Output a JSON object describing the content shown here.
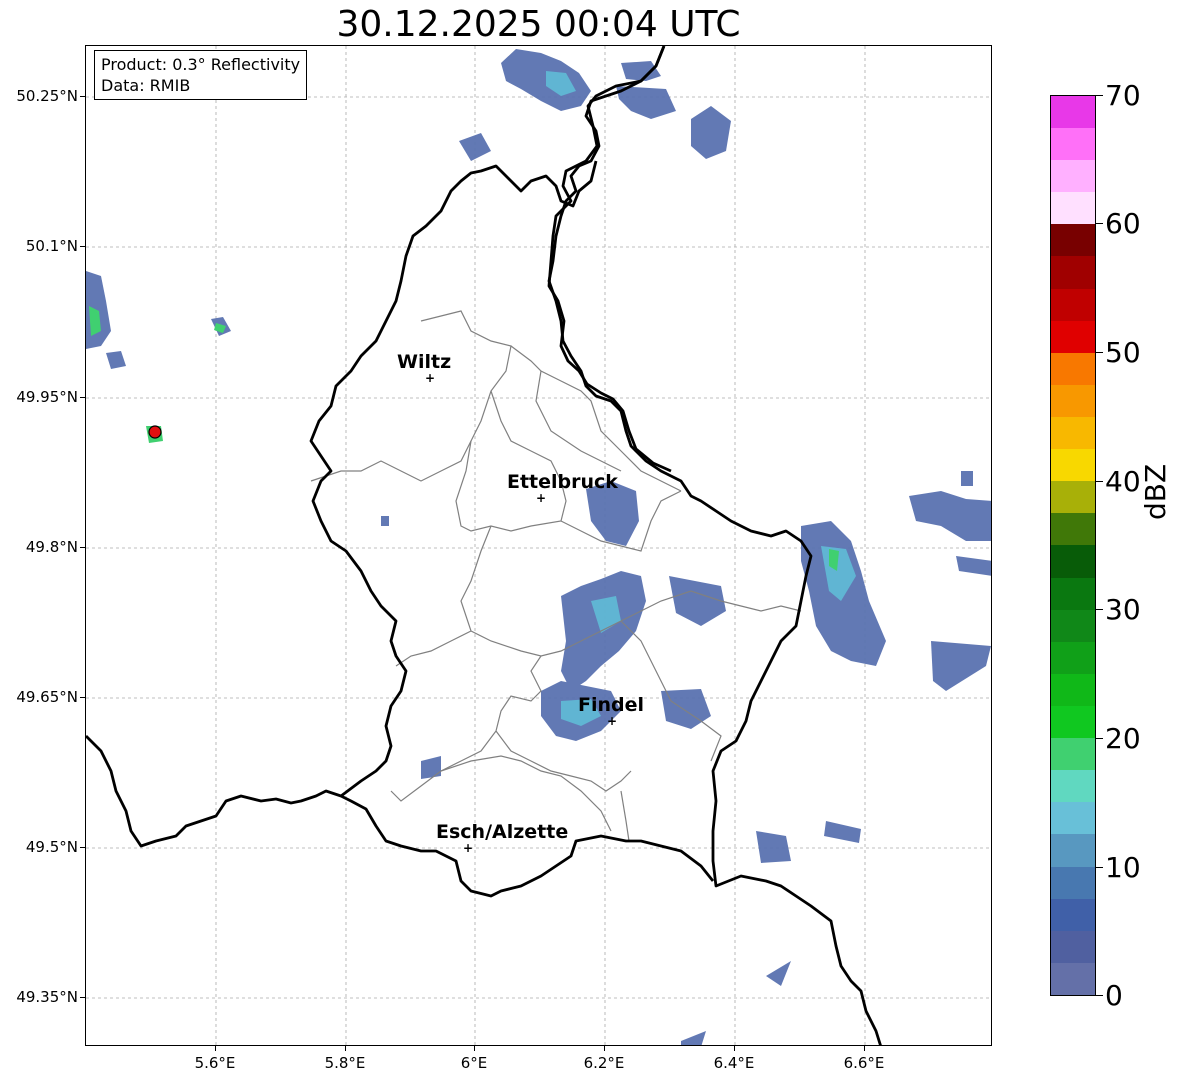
{
  "title": "30.12.2025 00:04 UTC",
  "info_box": {
    "product": "Product: 0.3° Reflectivity",
    "data": "Data: RMIB"
  },
  "axes": {
    "lat_ticks": [
      "50.25°N",
      "50.1°N",
      "49.95°N",
      "49.8°N",
      "49.65°N",
      "49.5°N",
      "49.35°N"
    ],
    "lon_ticks": [
      "5.6°E",
      "5.8°E",
      "6°E",
      "6.2°E",
      "6.4°E",
      "6.6°E"
    ]
  },
  "cities": [
    {
      "name": "Wiltz"
    },
    {
      "name": "Ettelbruck"
    },
    {
      "name": "Findel"
    },
    {
      "name": "Esch/Alzette"
    }
  ],
  "colorbar": {
    "label": "dBZ",
    "ticks": [
      "0",
      "10",
      "20",
      "30",
      "40",
      "50",
      "60",
      "70"
    ],
    "range": [
      0,
      70
    ],
    "colors": [
      "#6470a8",
      "#5060a0",
      "#4060a8",
      "#4878b0",
      "#5898c0",
      "#68c0d8",
      "#60d8c0",
      "#40d070",
      "#10c820",
      "#10b818",
      "#10a018",
      "#108818",
      "#0a7810",
      "#085c08",
      "#407808",
      "#a8b008",
      "#f8d800",
      "#f8b800",
      "#f89800",
      "#f87800",
      "#e00000",
      "#c00000",
      "#a00000",
      "#780000",
      "#ffe0ff",
      "#ffb0ff",
      "#ff70f8",
      "#e838e8"
    ]
  },
  "marker_color": "#e01010"
}
